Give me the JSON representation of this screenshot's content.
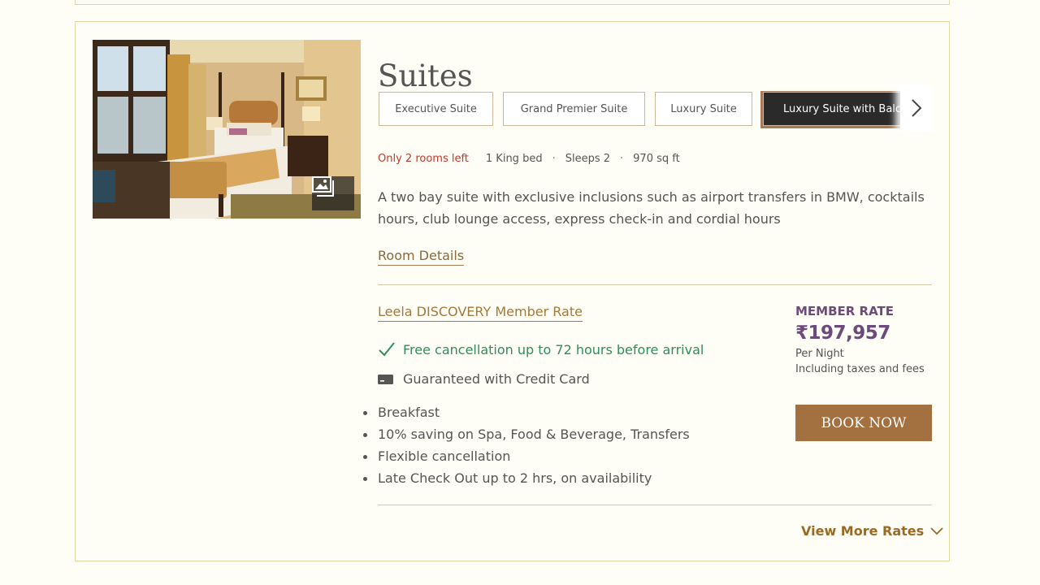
{
  "room": {
    "title": "Suites",
    "image_alt": "Suite bedroom",
    "gallery_icon": "gallery-icon",
    "tabs": [
      {
        "label": "Executive Suite",
        "active": false
      },
      {
        "label": "Grand Premier Suite",
        "active": false
      },
      {
        "label": "Luxury Suite",
        "active": false
      },
      {
        "label": "Luxury Suite with Balc",
        "active": true
      }
    ],
    "next_icon": "chevron-right-icon",
    "urgency": "Only 2 rooms left",
    "bed": "1 King bed",
    "sleeps": "Sleeps 2",
    "area": "970 sq ft",
    "description": "A two bay suite with exclusive inclusions such as airport transfers in BMW, cocktails hours, club lounge access, express check-in and cordial hours",
    "details_link": "Room Details"
  },
  "rate": {
    "name": "Leela DISCOVERY Member Rate",
    "cancellation": "Free cancellation up to 72 hours before arrival",
    "guarantee": "Guaranteed with Credit Card",
    "benefits": [
      "Breakfast",
      "10% saving on Spa, Food & Beverage, Transfers",
      "Flexible cancellation",
      "Late Check Out up to 2 hrs, on availability"
    ],
    "price_label": "MEMBER RATE",
    "price": "₹197,957",
    "per_night": "Per Night",
    "taxes": "Including taxes and fees",
    "book_label": "BOOK NOW"
  },
  "footer": {
    "view_more": "View More Rates"
  },
  "colors": {
    "urgency": "#c0392b",
    "cancellation": "#2e8e5a",
    "price": "#6c4a7a",
    "book_button": "#a3703f",
    "link": "#9a6a23"
  }
}
